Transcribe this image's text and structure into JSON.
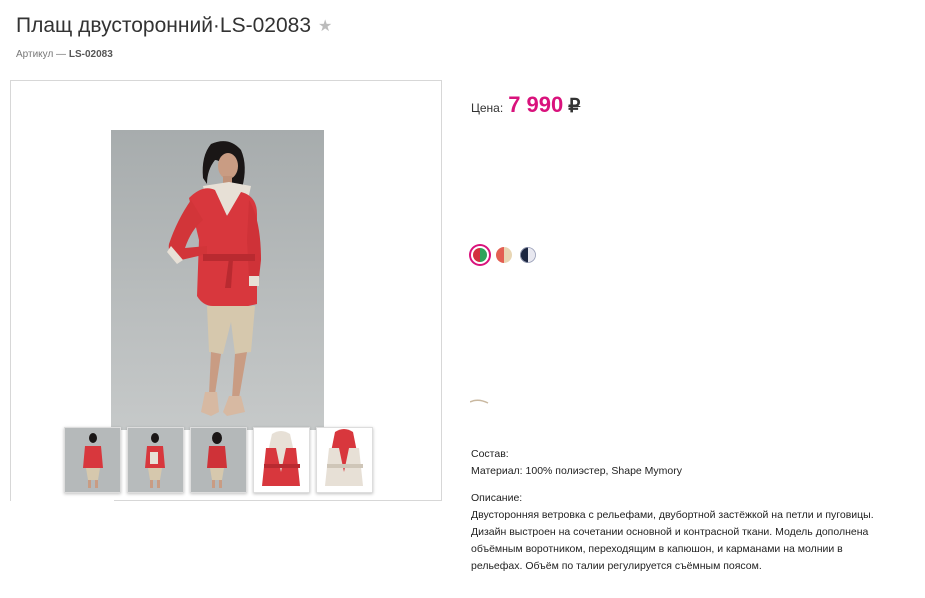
{
  "product": {
    "title": "Плащ двусторонний·LS-02083",
    "sku_label": "Артикул —",
    "sku_value": "LS-02083"
  },
  "price": {
    "label": "Цена:",
    "value": "7 990",
    "currency": "₽"
  },
  "colors": {
    "options": [
      {
        "name": "green-red",
        "colors": [
          "#d32f3f",
          "#2ea35a"
        ],
        "selected": true
      },
      {
        "name": "coral-beige",
        "colors": [
          "#e35f52",
          "#e8d6b4"
        ],
        "selected": false
      },
      {
        "name": "navy-white",
        "colors": [
          "#1b2640",
          "#e8e8f0"
        ],
        "selected": false
      }
    ]
  },
  "composition": {
    "heading": "Состав:",
    "material": "Материал: 100% полиэстер, Shape Mymory"
  },
  "description": {
    "heading": "Описание:",
    "line1": "Двусторонняя ветровка с рельефами, двубортной застёжкой на петли и пуговицы.",
    "line2": "Дизайн выстроен на сочетании основной и контрасной ткани. Модель дополнена",
    "line3": "объёмным воротником, переходящим в капюшон, и карманами на молнии в",
    "line4": "рельефах. Объём по талии регулируется съёмным поясом."
  },
  "icons": {
    "favorite": "star-icon"
  }
}
